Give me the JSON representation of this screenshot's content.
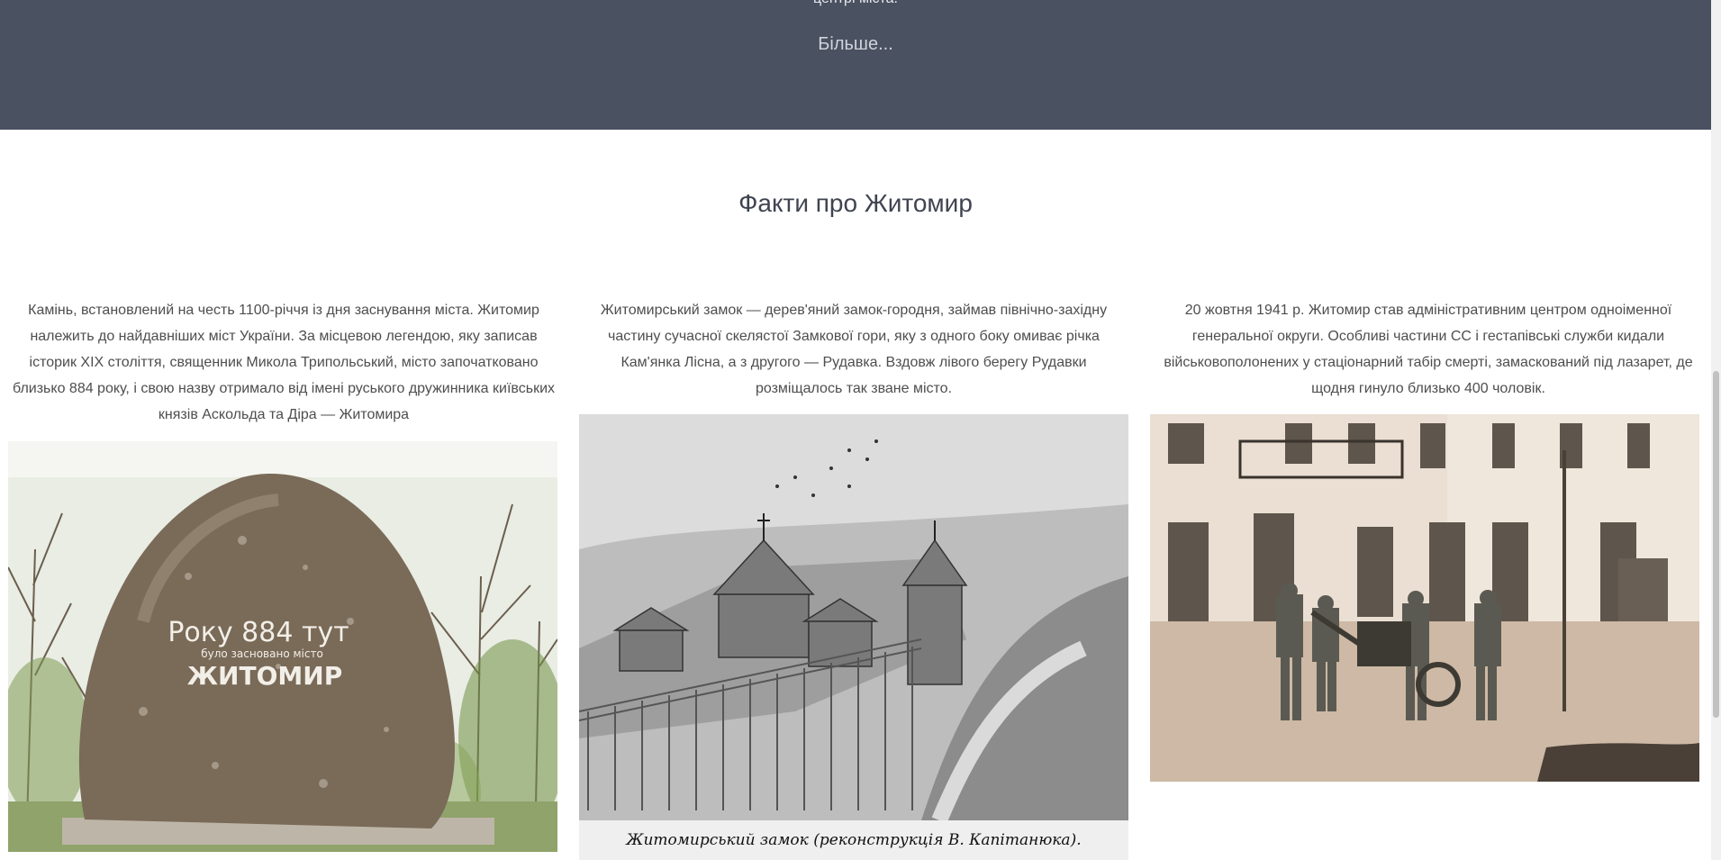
{
  "top_band": {
    "partial_text": "центрі міста.",
    "more_label": "Більше..."
  },
  "facts": {
    "title": "Факти про Житомир",
    "items": [
      {
        "text": "Камінь, встановлений на честь 1100-річчя із дня заснування міста. Житомир належить до найдавніших міст України. За місцевою легендою, яку записав історик XIX століття, священник Микола Трипольський, місто започатковано близько 884 року, і свою назву отримало від імені руського дружинника київських князів Аскольда та Діра — Житомира",
        "image": {
          "inscription_line1": "Року 884 тут",
          "inscription_line2": "було засновано місто",
          "inscription_line3": "ЖИТОМИР"
        }
      },
      {
        "text": "Житомирський замок — дерев'яний замок-городня, займав північно-західну частину сучасної скелястої Замкової гори, яку з одного боку омиває річка Кам'янка Лісна, а з другого — Рудавка. Вздовж лівого берегу Рудавки розміщалось так зване місто.",
        "image": {
          "caption": "Житомирський замок (реконструкція В. Капітанюка)."
        }
      },
      {
        "text": "20 жовтня 1941 р. Житомир став адміністративним центром одноіменної генеральної округи. Особливі частини СС і гестапівські служби кидали військовополонених у стаціонарний табір смерті, замаскований під лазарет, де щодня гинуло близько 400 чоловік.",
        "image": {}
      }
    ]
  }
}
